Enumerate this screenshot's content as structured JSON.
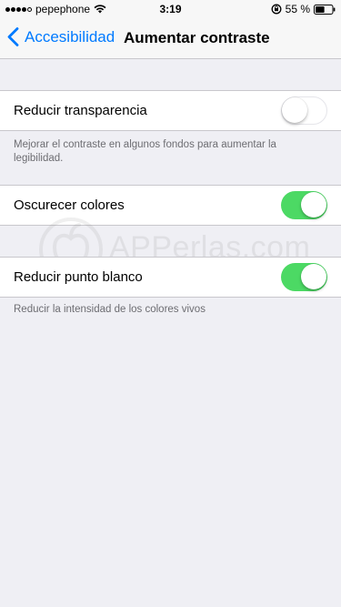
{
  "status_bar": {
    "carrier": "pepephone",
    "time": "3:19",
    "battery_percent": "55 %",
    "signal_strength": 4,
    "signal_max": 5,
    "battery_level": 0.55
  },
  "nav": {
    "back_label": "Accesibilidad",
    "title": "Aumentar contraste"
  },
  "settings": {
    "reduce_transparency": {
      "label": "Reducir transparencia",
      "enabled": false,
      "footnote": "Mejorar el contraste en algunos fondos para aumentar la legibilidad."
    },
    "darken_colors": {
      "label": "Oscurecer colores",
      "enabled": true
    },
    "reduce_white_point": {
      "label": "Reducir punto blanco",
      "enabled": true,
      "footnote": "Reducir la intensidad de los colores vivos"
    }
  },
  "watermark": {
    "text": "APPerlas.com"
  },
  "colors": {
    "accent": "#007aff",
    "toggle_on": "#4cd964",
    "background": "#efeff4",
    "footnote": "#6d6d72"
  }
}
